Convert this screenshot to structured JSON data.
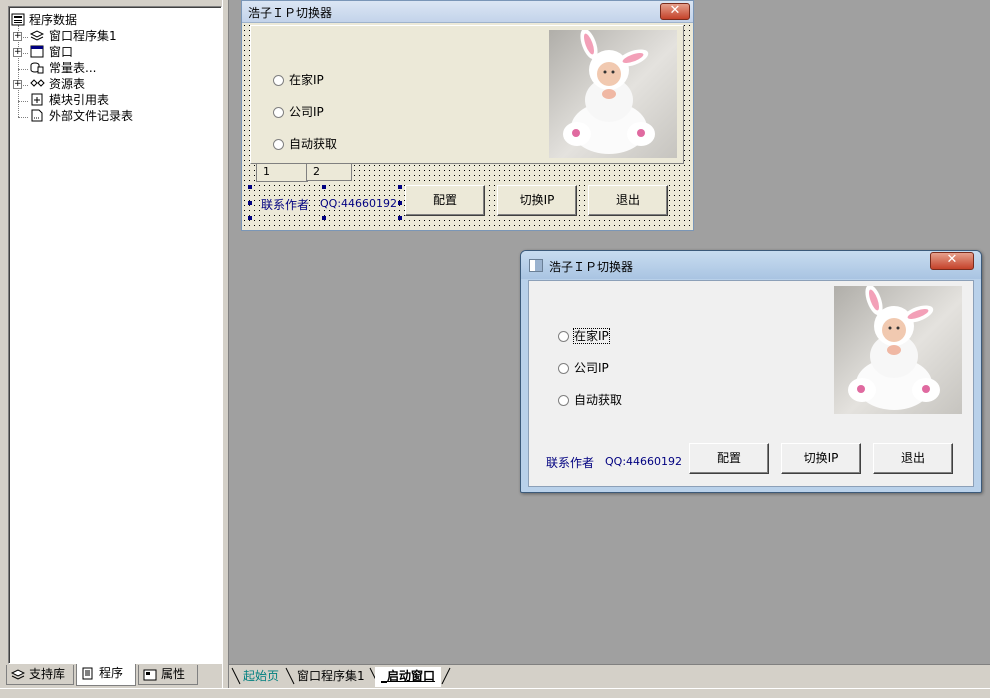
{
  "tree": {
    "root": "程序数据",
    "items": [
      {
        "label": "窗口程序集1",
        "icon": "layers-icon",
        "expandable": true
      },
      {
        "label": "窗口",
        "icon": "window-icon",
        "expandable": true
      },
      {
        "label": "常量表...",
        "icon": "constants-icon",
        "expandable": false
      },
      {
        "label": "资源表",
        "icon": "resources-icon",
        "expandable": true
      },
      {
        "label": "模块引用表",
        "icon": "module-icon",
        "expandable": false
      },
      {
        "label": "外部文件记录表",
        "icon": "file-icon",
        "expandable": false
      }
    ]
  },
  "left_tabs": [
    {
      "label": "支持库",
      "icon": "library-icon"
    },
    {
      "label": "程序",
      "icon": "program-icon"
    },
    {
      "label": "属性",
      "icon": "properties-icon"
    }
  ],
  "bottom_tabs": [
    {
      "label": "起始页"
    },
    {
      "label": "窗口程序集1"
    },
    {
      "label": "_启动窗口"
    }
  ],
  "design_window": {
    "title": "浩子ＩＰ切换器",
    "close": "✕",
    "radios": [
      "在家IP",
      "公司IP",
      "自动获取"
    ],
    "tabs": [
      "1",
      "2"
    ],
    "contact_label": "联系作者",
    "qq": "QQ:44660192",
    "buttons": [
      "配置",
      "切换IP",
      "退出"
    ]
  },
  "run_window": {
    "title": "浩子ＩＰ切换器",
    "close": "✕",
    "radios": [
      "在家IP",
      "公司IP",
      "自动获取"
    ],
    "contact_label": "联系作者",
    "qq": "QQ:44660192",
    "buttons": [
      "配置",
      "切换IP",
      "退出"
    ]
  },
  "colors": {
    "workspace": "#a0a0a0",
    "link": "#000080",
    "panel": "#d4d0c8"
  }
}
